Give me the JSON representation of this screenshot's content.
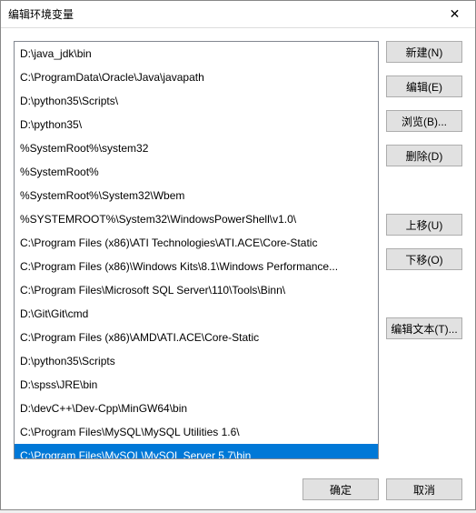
{
  "window": {
    "title": "编辑环境变量"
  },
  "list": {
    "items": [
      "D:\\java_jdk\\bin",
      "C:\\ProgramData\\Oracle\\Java\\javapath",
      "D:\\python35\\Scripts\\",
      "D:\\python35\\",
      "%SystemRoot%\\system32",
      "%SystemRoot%",
      "%SystemRoot%\\System32\\Wbem",
      "%SYSTEMROOT%\\System32\\WindowsPowerShell\\v1.0\\",
      "C:\\Program Files (x86)\\ATI Technologies\\ATI.ACE\\Core-Static",
      "C:\\Program Files (x86)\\Windows Kits\\8.1\\Windows Performance...",
      "C:\\Program Files\\Microsoft SQL Server\\110\\Tools\\Binn\\",
      "D:\\Git\\Git\\cmd",
      "C:\\Program Files (x86)\\AMD\\ATI.ACE\\Core-Static",
      "D:\\python35\\Scripts",
      "D:\\spss\\JRE\\bin",
      "D:\\devC++\\Dev-Cpp\\MinGW64\\bin",
      "C:\\Program Files\\MySQL\\MySQL Utilities 1.6\\",
      "C:\\Program Files\\MySQL\\MySQL Server 5.7\\bin"
    ],
    "selected_index": 17
  },
  "buttons": {
    "new": "新建(N)",
    "edit": "编辑(E)",
    "browse": "浏览(B)...",
    "delete": "删除(D)",
    "move_up": "上移(U)",
    "move_down": "下移(O)",
    "edit_text": "编辑文本(T)...",
    "ok": "确定",
    "cancel": "取消"
  }
}
